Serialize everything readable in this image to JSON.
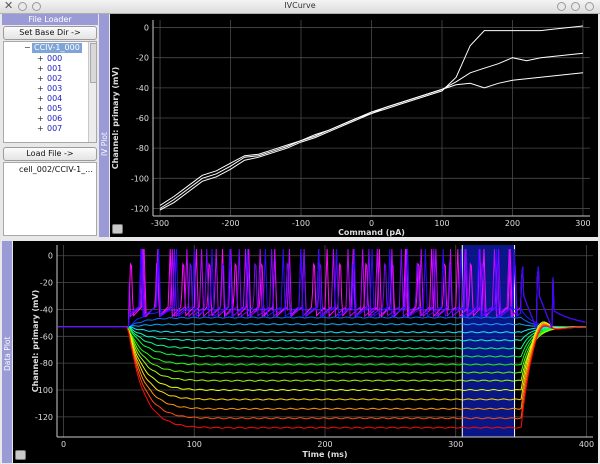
{
  "window": {
    "title": "IVCurve"
  },
  "file_loader": {
    "title": "File Loader",
    "set_base_dir_label": "Set Base Dir ->",
    "tree": {
      "root": "CCIV-1_000",
      "items": [
        "000",
        "001",
        "002",
        "003",
        "004",
        "005",
        "006",
        "007"
      ]
    },
    "load_file_label": "Load File ->",
    "loaded_files": [
      "cell_002/CCIV-1_..."
    ]
  },
  "iv_plot": {
    "dock_label": "IV Plot",
    "ylabel": "Channel: primary (mV)",
    "xlabel": "Command (pA)",
    "x_ticks": [
      "-300",
      "-200",
      "-100",
      "0",
      "100",
      "200",
      "300"
    ],
    "y_ticks": [
      "0",
      "-20",
      "-40",
      "-60",
      "-80",
      "-100",
      "-120"
    ],
    "chart_data": {
      "type": "line",
      "xlim": [
        -310,
        310
      ],
      "ylim": [
        -125,
        5
      ],
      "grid": true,
      "series": [
        {
          "x": [
            -300,
            -280,
            -260,
            -240,
            -220,
            -200,
            -180,
            -160,
            -140,
            -120,
            -100,
            -80,
            -60,
            -40,
            -20,
            0,
            20,
            40,
            60,
            80,
            100,
            120,
            140,
            160,
            180,
            200,
            220,
            240,
            260,
            280,
            300
          ],
          "y": [
            -118,
            -112,
            -105,
            -98,
            -95,
            -90,
            -85,
            -84,
            -81,
            -78,
            -75,
            -71,
            -68,
            -64,
            -60,
            -56,
            -53,
            -50,
            -47,
            -44,
            -41,
            -38,
            -37,
            -40,
            -37,
            -35,
            -34,
            -33,
            -32,
            -31,
            -30
          ]
        },
        {
          "x": [
            -300,
            -280,
            -260,
            -240,
            -220,
            -200,
            -180,
            -160,
            -140,
            -120,
            -100,
            -80,
            -60,
            -40,
            -20,
            0,
            20,
            40,
            60,
            80,
            100,
            120,
            140,
            160,
            180,
            200,
            220,
            240,
            260,
            280,
            300
          ],
          "y": [
            -120,
            -114,
            -107,
            -100,
            -97,
            -92,
            -86,
            -85,
            -82,
            -79,
            -75,
            -72,
            -68,
            -64,
            -60,
            -57,
            -53,
            -50,
            -47,
            -44,
            -41,
            -36,
            -30,
            -27,
            -24,
            -20,
            -22,
            -20,
            -19,
            -18,
            -17
          ]
        },
        {
          "x": [
            -300,
            -280,
            -260,
            -240,
            -220,
            -200,
            -180,
            -160,
            -140,
            -120,
            -100,
            -80,
            -60,
            -40,
            -20,
            0,
            20,
            40,
            60,
            80,
            100,
            120,
            140,
            160,
            180,
            200,
            220,
            240,
            260,
            280,
            300
          ],
          "y": [
            -121,
            -116,
            -109,
            -102,
            -99,
            -94,
            -88,
            -86,
            -83,
            -80,
            -76,
            -73,
            -69,
            -65,
            -61,
            -57,
            -54,
            -51,
            -48,
            -45,
            -42,
            -33,
            -12,
            -2,
            -2,
            -2,
            -2,
            -2,
            -1,
            0,
            1
          ]
        }
      ]
    }
  },
  "data_plot": {
    "dock_label": "Data Plot",
    "ylabel": "Channel: primary (mV)",
    "xlabel": "Time (ms)",
    "x_ticks": [
      "0",
      "100",
      "200",
      "300",
      "400"
    ],
    "y_ticks": [
      "0",
      "-20",
      "-40",
      "-60",
      "-80",
      "-100",
      "-120"
    ],
    "region_ms": [
      305,
      345
    ],
    "chart_data": {
      "type": "line",
      "xlim": [
        -5,
        405
      ],
      "ylim": [
        -135,
        8
      ],
      "grid": true,
      "step_on_ms": 50,
      "step_off_ms": 350,
      "baseline_mV": -53,
      "hyperpolarized_levels_mV": [
        -40,
        -46,
        -51,
        -57,
        -63,
        -69,
        -75,
        -81,
        -87,
        -93,
        -100,
        -107,
        -114,
        -121,
        -128
      ],
      "spiking_traces": 4,
      "spike_peak_mV": 5,
      "spike_trough_mV": -40
    }
  },
  "colors": {
    "accent": "#9a9ad6",
    "plot_bg": "#000000",
    "grid": "#4a4a4a",
    "selection": "#0a1a9e"
  }
}
